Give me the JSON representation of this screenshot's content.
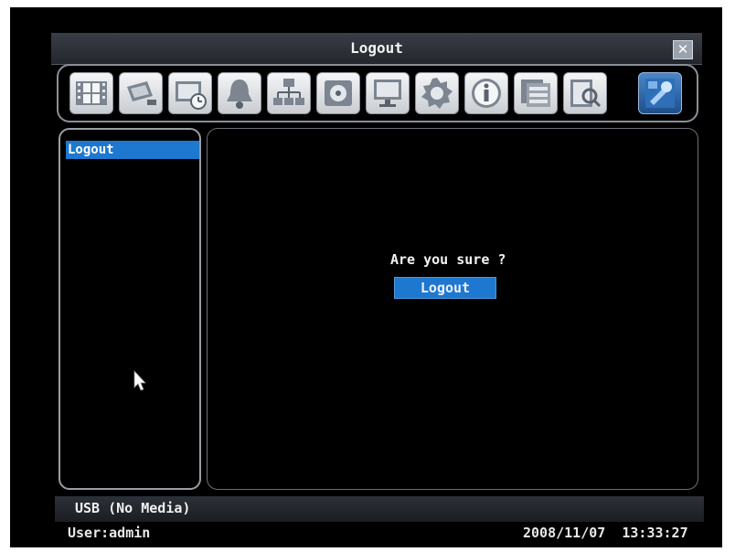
{
  "window": {
    "title": "Logout",
    "close_icon": "close-icon"
  },
  "toolbar": {
    "items": [
      {
        "icon": "film-strip-icon"
      },
      {
        "icon": "camera-icon"
      },
      {
        "icon": "schedule-record-icon"
      },
      {
        "icon": "alarm-bell-icon"
      },
      {
        "icon": "network-icon"
      },
      {
        "icon": "disk-icon"
      },
      {
        "icon": "monitor-icon"
      },
      {
        "icon": "gear-icon"
      },
      {
        "icon": "info-icon"
      },
      {
        "icon": "event-log-icon"
      },
      {
        "icon": "search-icon"
      },
      {
        "icon": "logout-icon",
        "active": true
      }
    ]
  },
  "sidebar": {
    "items": [
      {
        "label": "Logout",
        "selected": true
      }
    ]
  },
  "main": {
    "question": "Are you sure ?",
    "logout_label": "Logout"
  },
  "status": {
    "text": "USB (No Media)"
  },
  "footer": {
    "user": "User:admin",
    "datetime": "2008/11/07  13:33:27"
  },
  "colors": {
    "highlight": "#1e78cf",
    "background": "#000000",
    "text": "#f2f2f2"
  }
}
